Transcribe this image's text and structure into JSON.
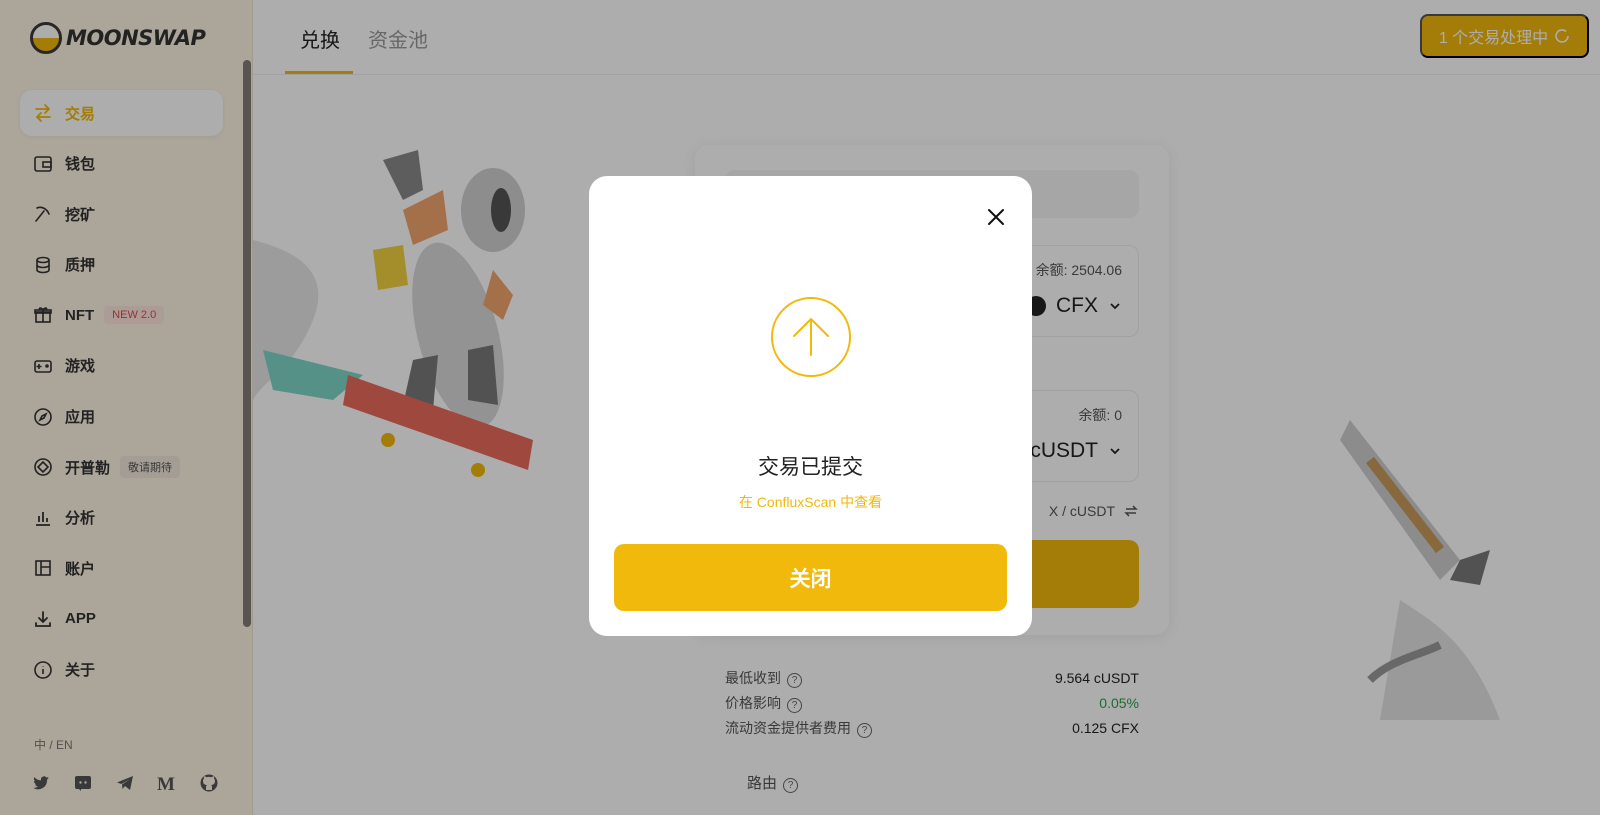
{
  "brand": {
    "name": "MOONSWAP"
  },
  "sidebar": {
    "items": [
      {
        "label": "交易",
        "icon": "swap-arrows-icon",
        "active": true
      },
      {
        "label": "钱包",
        "icon": "wallet-icon"
      },
      {
        "label": "挖矿",
        "icon": "pickaxe-icon"
      },
      {
        "label": "质押",
        "icon": "coins-stack-icon"
      },
      {
        "label": "NFT",
        "icon": "gift-icon",
        "badge": "NEW 2.0"
      },
      {
        "label": "游戏",
        "icon": "gamepad-icon"
      },
      {
        "label": "应用",
        "icon": "compass-icon"
      },
      {
        "label": "开普勒",
        "icon": "diamond-icon",
        "badge": "敬请期待"
      },
      {
        "label": "分析",
        "icon": "bar-chart-icon"
      },
      {
        "label": "账户",
        "icon": "layout-icon"
      },
      {
        "label": "APP",
        "icon": "download-icon"
      },
      {
        "label": "关于",
        "icon": "info-icon"
      }
    ],
    "language": "中 / EN",
    "social": [
      "twitter-icon",
      "discord-icon",
      "telegram-icon",
      "medium-icon",
      "github-icon"
    ]
  },
  "header": {
    "tabs": [
      {
        "label": "兑换",
        "active": true
      },
      {
        "label": "资金池",
        "active": false
      }
    ],
    "pending_label": "1 个交易处理中"
  },
  "swap": {
    "from": {
      "balance": "余额: 2504.06",
      "token": "CFX"
    },
    "to": {
      "balance": "余额: 0",
      "token": "cUSDT"
    },
    "price_pair": "X / cUSDT"
  },
  "details": [
    {
      "label": "最低收到",
      "value": "9.564 cUSDT"
    },
    {
      "label": "价格影响",
      "value": "0.05%"
    },
    {
      "label": "流动资金提供者费用",
      "value": "0.125 CFX"
    }
  ],
  "route_label": "路由",
  "modal": {
    "title": "交易已提交",
    "link": "在 ConfluxScan 中查看",
    "close_button": "关闭"
  },
  "colors": {
    "accent": "#f0b90b",
    "positive": "#2aa04a",
    "sidebar_bg": "#fdf3e4"
  }
}
